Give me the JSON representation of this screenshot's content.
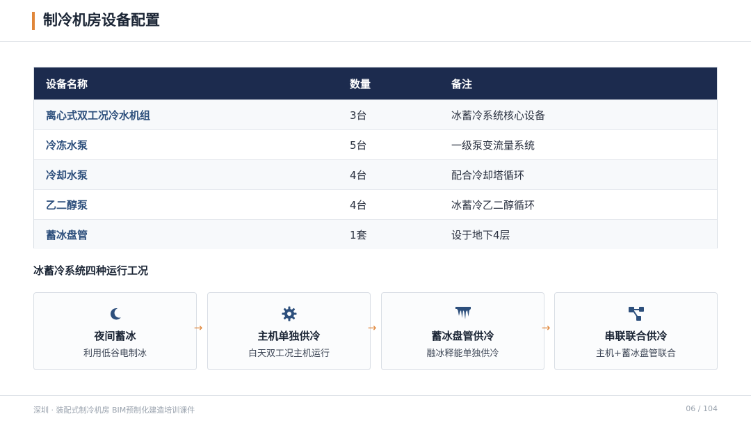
{
  "header": {
    "title": "制冷机房设备配置",
    "accent_color": "#e0863a"
  },
  "table": {
    "header_bg": "#1c2b4e",
    "columns": [
      "设备名称",
      "数量",
      "备注"
    ],
    "rows": [
      {
        "name": "离心式双工况冷水机组",
        "qty": "3台",
        "note": "冰蓄冷系统核心设备"
      },
      {
        "name": "冷冻水泵",
        "qty": "5台",
        "note": "一级泵变流量系统"
      },
      {
        "name": "冷却水泵",
        "qty": "4台",
        "note": "配合冷却塔循环"
      },
      {
        "name": "乙二醇泵",
        "qty": "4台",
        "note": "冰蓄冷乙二醇循环"
      },
      {
        "name": "蓄冰盘管",
        "qty": "1套",
        "note": "设于地下4层"
      }
    ]
  },
  "section": {
    "title": "冰蓄冷系统四种运行工况"
  },
  "modes": [
    {
      "icon": "moon-icon",
      "title": "夜间蓄冰",
      "desc": "利用低谷电制冰"
    },
    {
      "icon": "gear-icon",
      "title": "主机单独供冷",
      "desc": "白天双工况主机运行"
    },
    {
      "icon": "icicle-icon",
      "title": "蓄冰盘管供冷",
      "desc": "融冰释能单独供冷"
    },
    {
      "icon": "network-icon",
      "title": "串联联合供冷",
      "desc": "主机+蓄冰盘管联合"
    }
  ],
  "arrow_glyph": "→",
  "footer": {
    "left": "深圳 · 装配式制冷机房 BIM预制化建造培训课件",
    "page": "06 / 104"
  }
}
